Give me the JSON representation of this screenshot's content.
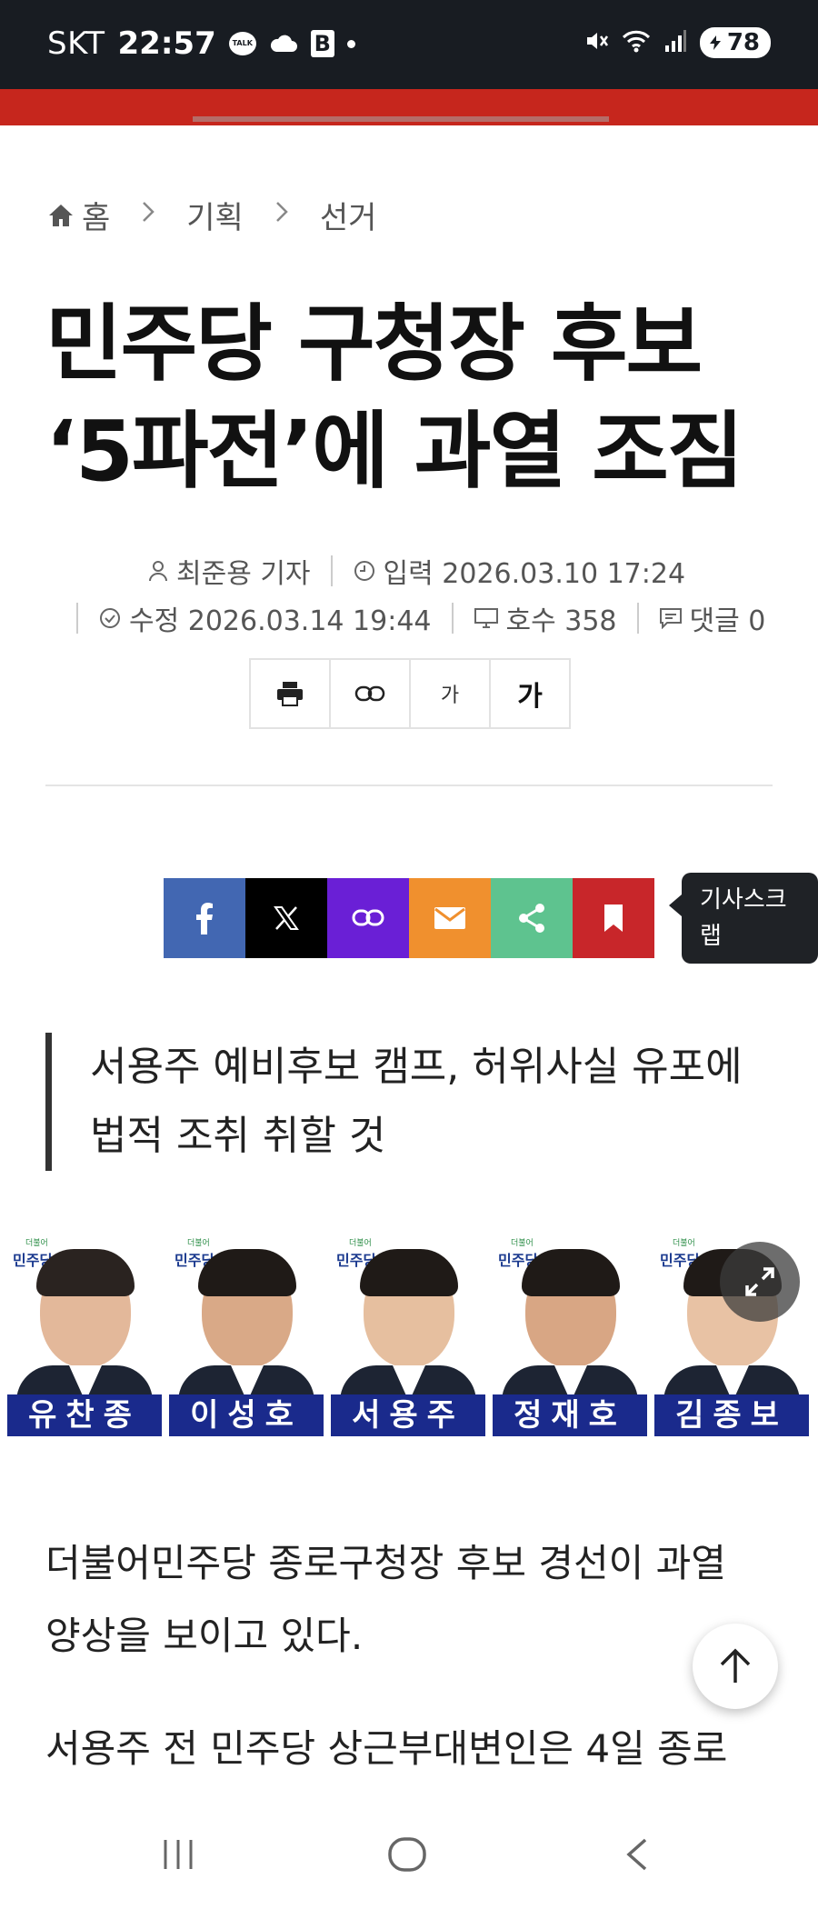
{
  "status_bar": {
    "carrier": "SKT",
    "time": "22:57",
    "talk_badge": "TALK",
    "app_badge": "B",
    "battery": "78"
  },
  "breadcrumb": {
    "items": [
      "홈",
      "기획",
      "선거"
    ]
  },
  "article": {
    "headline_line1": "민주당 구청장 후보",
    "headline_line2": "‘5파전’에 과열 조짐",
    "reporter": "최준용 기자",
    "published": "입력 2026.03.10 17:24",
    "modified": "수정 2026.03.14 19:44",
    "issue": "호수 358",
    "comments": "댓글 0",
    "subtitle": "서용주 예비후보 캠프, 허위사실 유포에 법적 조취 취할 것",
    "paragraph1": "더불어민주당 종로구청장 후보 경선이 과열 양상을 보이고 있다.",
    "paragraph2": "서용주 전 민주당 상근부대변인은 4일 종로"
  },
  "tools": {
    "font_small": "가",
    "font_large": "가"
  },
  "share": {
    "tooltip": "기사스크랩",
    "colors": {
      "facebook": "#4267b2",
      "x": "#000000",
      "link": "#6a1fd6",
      "email": "#f0902e",
      "share": "#5ec38f",
      "bookmark": "#c8262a"
    }
  },
  "candidates": {
    "party": "민주당",
    "party_small": "더불어",
    "names": [
      "유찬종",
      "이성호",
      "서용주",
      "정재호",
      "김종보"
    ]
  },
  "colors": {
    "brand_red": "#c6261d",
    "status_bar": "#181c22",
    "name_bar": "#1a2a8c"
  }
}
